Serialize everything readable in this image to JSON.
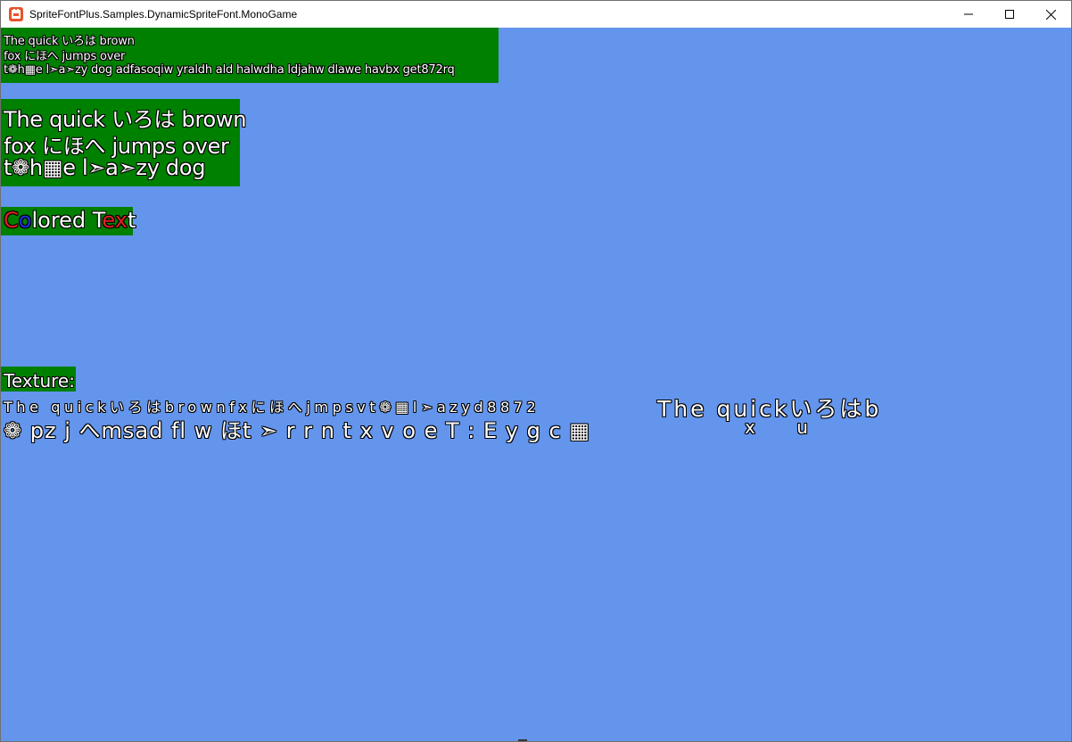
{
  "window": {
    "title": "SpriteFontPlus.Samples.DynamicSpriteFont.MonoGame",
    "background": "#6495ed",
    "block_color": "#008000"
  },
  "small_text": {
    "line1": "The quick いろは brown",
    "line2": "fox にほへ jumps over",
    "line3": "t❁h▦e l➣a➣zy dog adfasoqiw yraldh ald halwdha ldjahw dlawe havbx get872rq"
  },
  "big_text": {
    "line1": "The quick いろは brown",
    "line2": "fox にほへ jumps over",
    "line3": "t❁h▦e l➣a➣zy dog"
  },
  "colored_text": {
    "letters": [
      {
        "ch": "C",
        "color": "#e02020"
      },
      {
        "ch": "o",
        "color": "#2030e0"
      },
      {
        "ch": "l",
        "color": "#ffffff"
      },
      {
        "ch": "o",
        "color": "#ffffff"
      },
      {
        "ch": "r",
        "color": "#ffffff"
      },
      {
        "ch": "e",
        "color": "#ffffff"
      },
      {
        "ch": "d",
        "color": "#ffffff"
      },
      {
        "ch": " ",
        "color": "#ffffff"
      },
      {
        "ch": "T",
        "color": "#ffffff"
      },
      {
        "ch": "e",
        "color": "#e02020"
      },
      {
        "ch": "x",
        "color": "#e02020"
      },
      {
        "ch": "t",
        "color": "#ffffff"
      }
    ]
  },
  "texture": {
    "label": "Texture:",
    "row1_small": "The quickいろはbrownfxにほへjmpsvt❁▦l➣azyd8872",
    "row1_large": "The quickいろはb",
    "row1_sub": "x u",
    "row2": "❁ pz j へmsad fl w ほt ➣ r r n t x v o e T : E y g c ▦"
  }
}
